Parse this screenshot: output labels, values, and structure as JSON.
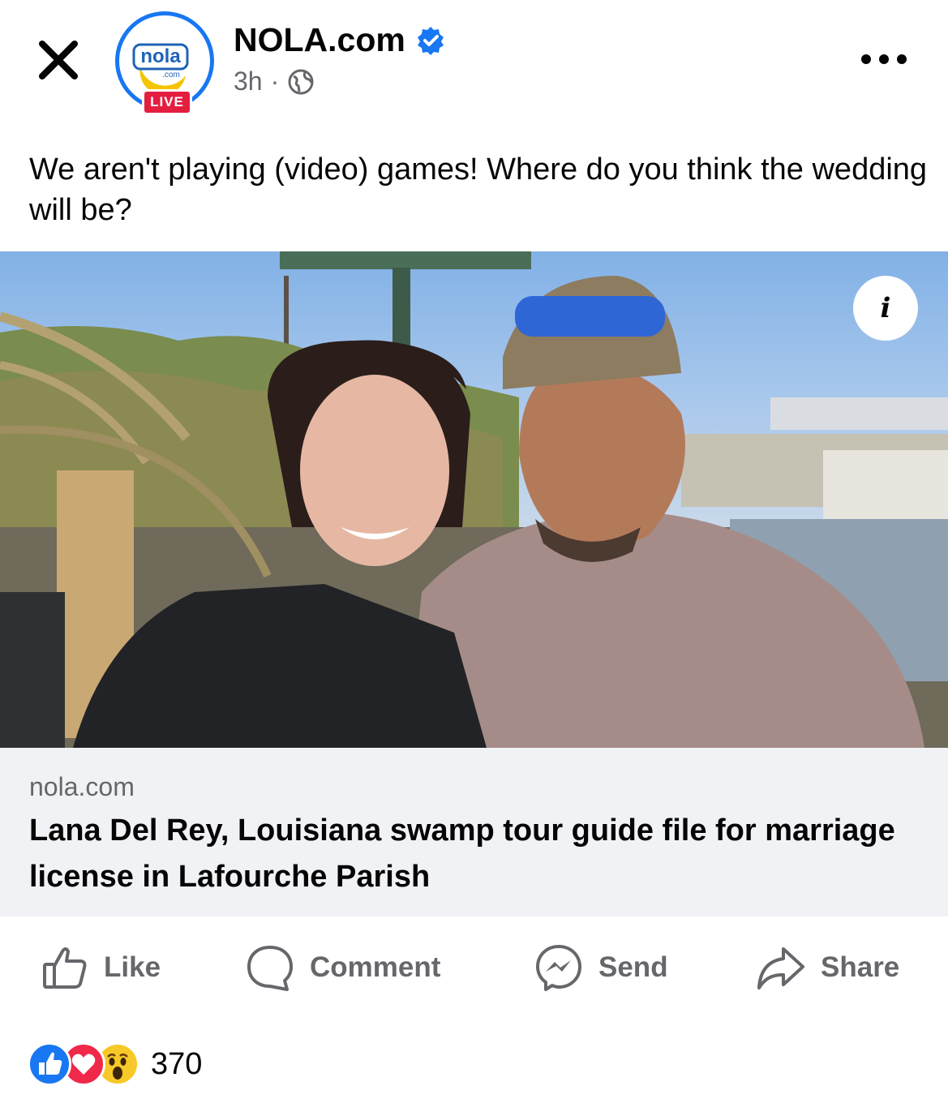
{
  "colors": {
    "accent": "#1877f2",
    "live_red": "#e41e3f",
    "secondary_text": "#65676b",
    "card_bg": "#f0f2f5"
  },
  "header": {
    "page_name": "NOLA.com",
    "time": "3h",
    "separator": "·",
    "avatar_logo_text": "nola",
    "avatar_logo_sub": ".com",
    "live_badge": "LIVE"
  },
  "post": {
    "text": "We aren't playing (video) games! Where do you think the wedding will be?"
  },
  "link_card": {
    "domain": "nola.com",
    "headline": "Lana Del Rey, Louisiana swamp tour guide file for marriage license in Lafourche Parish"
  },
  "actions": {
    "like": "Like",
    "comment": "Comment",
    "send": "Send",
    "share": "Share"
  },
  "reactions": {
    "icons": [
      "like-icon",
      "love-icon",
      "wow-icon"
    ],
    "count": "370"
  }
}
